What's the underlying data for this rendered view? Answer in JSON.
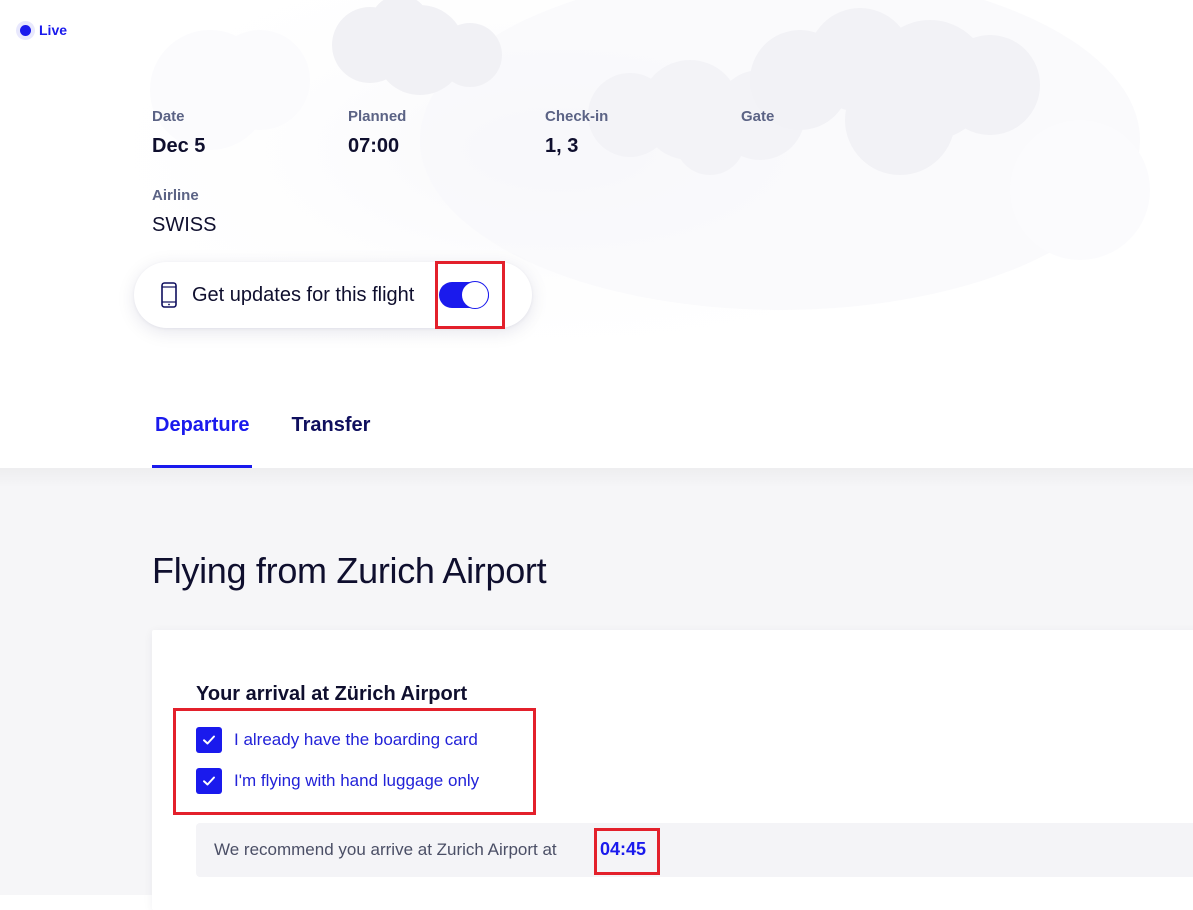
{
  "live": {
    "label": "Live"
  },
  "flight_info": {
    "date": {
      "label": "Date",
      "value": "Dec 5"
    },
    "planned": {
      "label": "Planned",
      "value": "07:00"
    },
    "checkin": {
      "label": "Check-in",
      "value": "1, 3"
    },
    "gate": {
      "label": "Gate",
      "value": ""
    },
    "airline": {
      "label": "Airline",
      "value": "SWISS"
    }
  },
  "updates": {
    "label": "Get updates for this flight",
    "enabled": true,
    "icon": "phone-icon"
  },
  "tabs": [
    {
      "label": "Departure",
      "active": true
    },
    {
      "label": "Transfer",
      "active": false
    }
  ],
  "section": {
    "title": "Flying from Zurich Airport"
  },
  "arrival_card": {
    "title": "Your arrival at Zürich Airport",
    "options": [
      {
        "label": "I already have the boarding card",
        "checked": true
      },
      {
        "label": "I'm flying with hand luggage only",
        "checked": true
      }
    ],
    "recommendation_text": "We recommend you arrive at Zurich Airport at",
    "recommendation_time": "04:45"
  },
  "colors": {
    "accent": "#1a1aed",
    "text": "#0f0f2e",
    "label": "#5b6385",
    "highlight": "#e3202b"
  }
}
